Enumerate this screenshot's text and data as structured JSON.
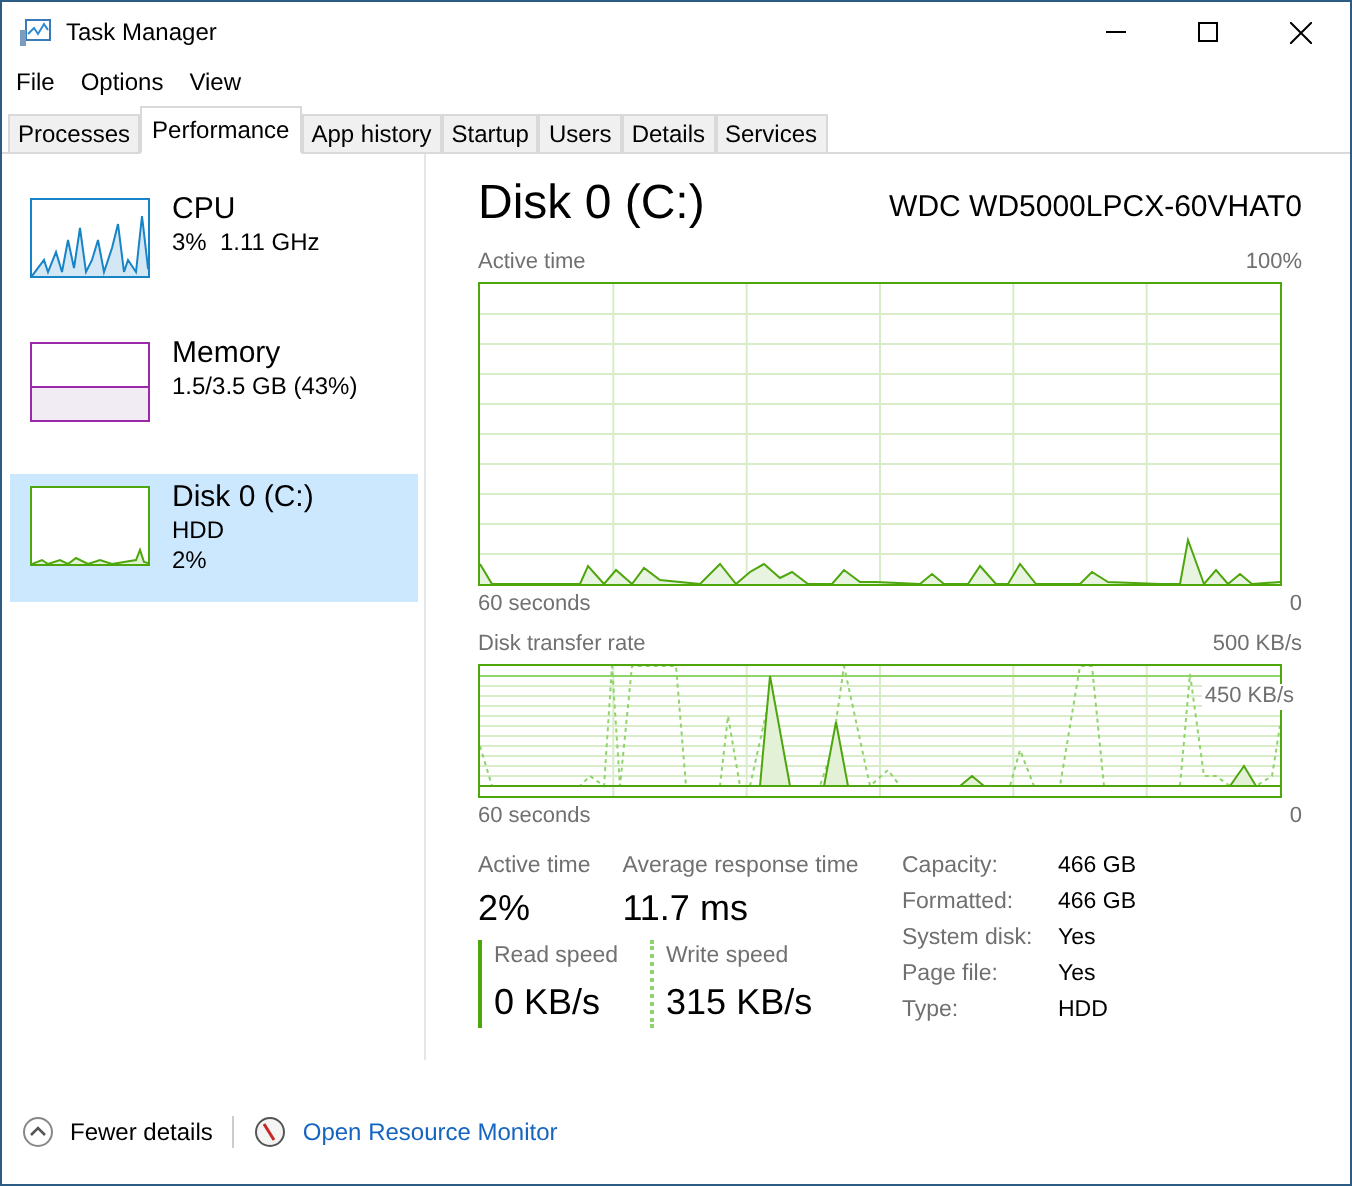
{
  "window": {
    "title": "Task Manager"
  },
  "menu": [
    "File",
    "Options",
    "View"
  ],
  "tabs": [
    {
      "label": "Processes",
      "selected": false
    },
    {
      "label": "Performance",
      "selected": true
    },
    {
      "label": "App history",
      "selected": false
    },
    {
      "label": "Startup",
      "selected": false
    },
    {
      "label": "Users",
      "selected": false
    },
    {
      "label": "Details",
      "selected": false
    },
    {
      "label": "Services",
      "selected": false
    }
  ],
  "sidebar": {
    "items": [
      {
        "kind": "cpu",
        "title": "CPU",
        "lines": [
          "3%  1.11 GHz"
        ],
        "selected": false
      },
      {
        "kind": "memory",
        "title": "Memory",
        "lines": [
          "1.5/3.5 GB (43%)"
        ],
        "selected": false
      },
      {
        "kind": "disk",
        "title": "Disk 0 (C:)",
        "lines": [
          "HDD",
          "2%"
        ],
        "selected": true
      }
    ]
  },
  "main": {
    "title": "Disk 0 (C:)",
    "model": "WDC WD5000LPCX-60VHAT0",
    "active_graph": {
      "label": "Active time",
      "max": "100%",
      "span": "60 seconds",
      "min": "0"
    },
    "transfer_graph": {
      "label": "Disk transfer rate",
      "max": "500 KB/s",
      "marker": "450 KB/s",
      "span": "60 seconds",
      "min": "0"
    },
    "stats": [
      {
        "label": "Active time",
        "value": "2%"
      },
      {
        "label": "Average response time",
        "value": "11.7 ms"
      }
    ],
    "speeds": [
      {
        "label": "Read speed",
        "value": "0 KB/s",
        "kind": "solid"
      },
      {
        "label": "Write speed",
        "value": "315 KB/s",
        "kind": "dotted"
      }
    ],
    "properties": [
      {
        "label": "Capacity:",
        "value": "466 GB"
      },
      {
        "label": "Formatted:",
        "value": "466 GB"
      },
      {
        "label": "System disk:",
        "value": "Yes"
      },
      {
        "label": "Page file:",
        "value": "Yes"
      },
      {
        "label": "Type:",
        "value": "HDD"
      }
    ]
  },
  "footer": {
    "details": "Fewer details",
    "monitor": "Open Resource Monitor"
  }
}
